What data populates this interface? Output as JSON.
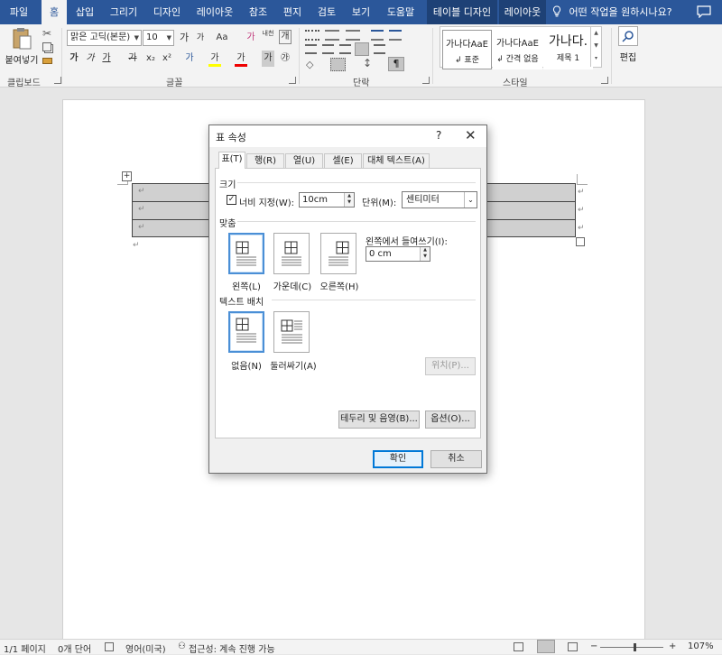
{
  "ribbon_tabs": [
    "파일",
    "홈",
    "삽입",
    "그리기",
    "디자인",
    "레이아웃",
    "참조",
    "편지",
    "검토",
    "보기",
    "도움말",
    "테이블 디자인",
    "레이아웃"
  ],
  "tell_me": "어떤 작업을 원하시나요?",
  "ribbon": {
    "clipboard": {
      "paste": "붙여넣기",
      "group": "클립보드"
    },
    "font": {
      "name": "맑은 고딕(본문)",
      "size": "10",
      "grow": "가",
      "shrink": "가",
      "case": "Aa",
      "clear": "가",
      "phonetic": "내천",
      "enclose": "개",
      "bold": "가",
      "italic": "가",
      "underline": "가",
      "strike": "가",
      "sub": "x₂",
      "sup": "x²",
      "effects": "가",
      "highlight": "가",
      "color": "가",
      "shade": "가",
      "encircle": "㉮",
      "group": "글꼴"
    },
    "paragraph": {
      "group": "단락"
    },
    "styles": {
      "items": [
        {
          "preview": "가나다AaE",
          "name": "↲ 표준"
        },
        {
          "preview": "가나다AaE",
          "name": "↲ 간격 없음"
        },
        {
          "preview": "가나다.",
          "name": "제목 1"
        }
      ],
      "group": "스타일"
    },
    "editing": {
      "label": "편집"
    }
  },
  "document": {
    "cell_mark": "↵",
    "para_mark": "↵",
    "rows": 3,
    "table_handle": "+"
  },
  "status": {
    "page": "1/1 페이지",
    "words": "0개 단어",
    "lang": "영어(미국)",
    "access": "접근성: 계속 진행 가능",
    "zoom": "107%",
    "zoom_minus": "−",
    "zoom_plus": "+"
  },
  "dialog": {
    "title": "표 속성",
    "help": "?",
    "close": "✕",
    "tabs": [
      "표(T)",
      "행(R)",
      "열(U)",
      "셀(E)",
      "대체 텍스트(A)"
    ],
    "size_section": "크기",
    "width_checkbox_label": "너비 지정(W):",
    "width_checked": "✓",
    "width_value": "10cm",
    "unit_label": "단위(M):",
    "unit_value": "센티미터",
    "align_section": "맞춤",
    "indent_label": "왼쪽에서 들여쓰기(I):",
    "indent_value": "0 cm",
    "align_options": [
      "왼쪽(L)",
      "가운데(C)",
      "오른쪽(H)"
    ],
    "wrap_section": "텍스트 배치",
    "wrap_options": [
      "없음(N)",
      "둘러싸기(A)"
    ],
    "position_button": "위치(P)...",
    "borders_button": "테두리 및 음영(B)...",
    "options_button": "옵션(O)...",
    "ok": "확인",
    "cancel": "취소"
  }
}
